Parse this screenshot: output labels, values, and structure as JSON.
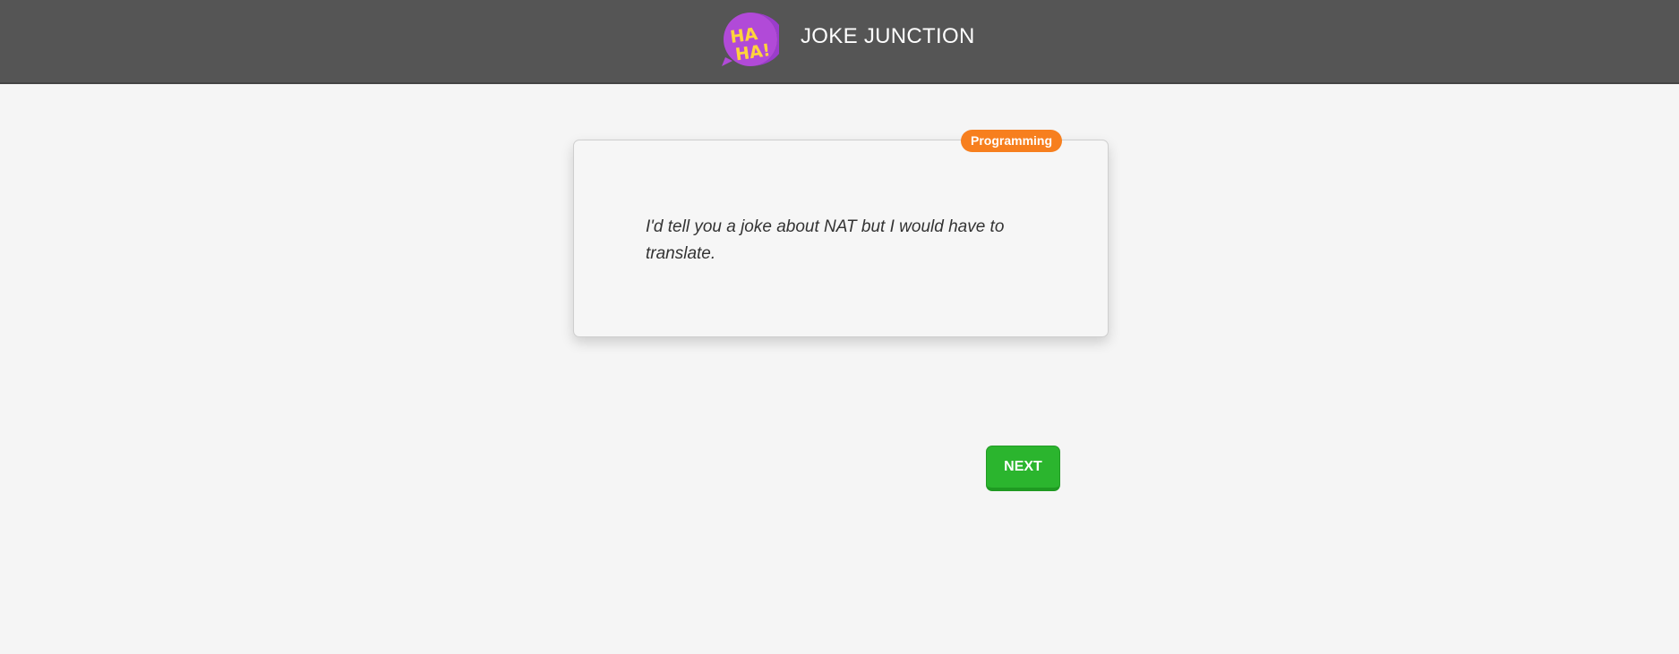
{
  "header": {
    "logo_text_line1": "HA",
    "logo_text_line2": "HA!",
    "title": "JOKE JUNCTION"
  },
  "joke": {
    "category": "Programming",
    "text": "I'd tell you a joke about NAT but I would have to translate."
  },
  "actions": {
    "next_label": "NEXT"
  },
  "colors": {
    "header_bg": "#555555",
    "page_bg": "#f5f5f5",
    "badge_bg": "#f77f1e",
    "next_bg": "#2bb52e",
    "logo_purple": "#a647d6",
    "logo_yellow": "#ffd43b"
  },
  "icons": {
    "logo": "haha-speech-bubble-icon"
  }
}
